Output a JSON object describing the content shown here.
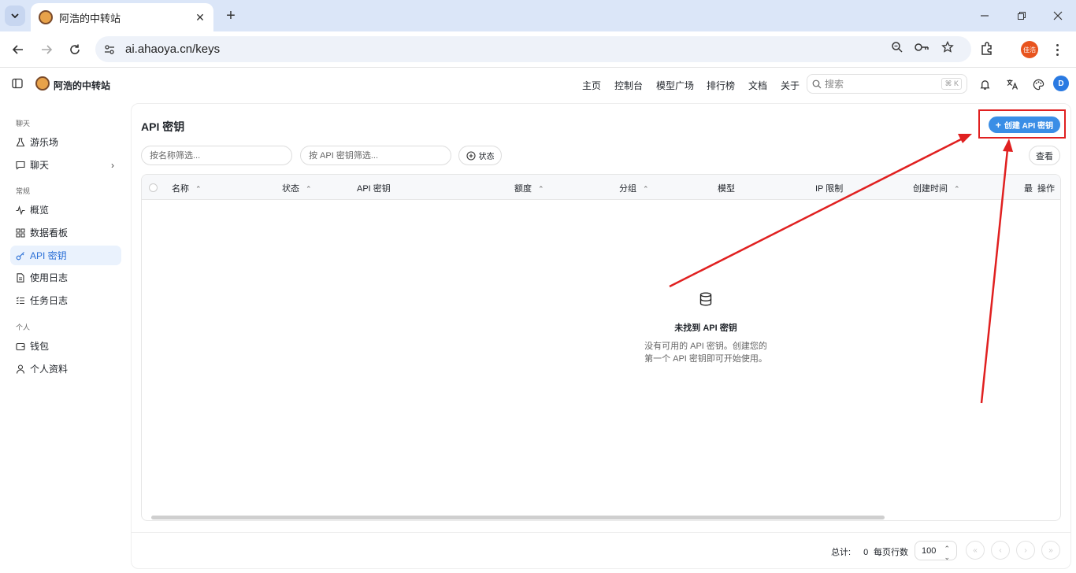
{
  "browser": {
    "tab_title": "阿浩的中转站",
    "url": "ai.ahaoya.cn/keys",
    "profile_label": "佳浩"
  },
  "app": {
    "brand": "阿浩的中转站",
    "nav": [
      "主页",
      "控制台",
      "模型广场",
      "排行榜",
      "文档",
      "关于"
    ],
    "search_placeholder": "搜索",
    "search_shortcut": "⌘ K",
    "avatar_letter": "D"
  },
  "sidebar": {
    "sections": [
      {
        "label": "聊天",
        "items": [
          "游乐场",
          "聊天"
        ]
      },
      {
        "label": "常规",
        "items": [
          "概览",
          "数据看板",
          "API 密钥",
          "使用日志",
          "任务日志"
        ]
      },
      {
        "label": "个人",
        "items": [
          "钱包",
          "个人资料"
        ]
      }
    ],
    "active": "API 密钥"
  },
  "page": {
    "title": "API 密钥",
    "create_button": "创建 API 密钥",
    "filter_name_placeholder": "按名称筛选...",
    "filter_key_placeholder": "按 API 密钥筛选...",
    "status_filter": "状态",
    "view_button": "查看"
  },
  "table": {
    "columns": [
      "名称",
      "状态",
      "API 密钥",
      "额度",
      "分组",
      "模型",
      "IP 限制",
      "创建时间",
      "最",
      "操作"
    ],
    "empty_title": "未找到 API 密钥",
    "empty_desc_line1": "没有可用的 API 密钥。创建您的",
    "empty_desc_line2": "第一个 API 密钥即可开始使用。"
  },
  "pagination": {
    "total_label": "总计:",
    "total_value": "0",
    "rows_label": "每页行数",
    "rows_value": "100"
  },
  "colors": {
    "accent": "#3a8ee6",
    "annotation": "#e02020"
  }
}
